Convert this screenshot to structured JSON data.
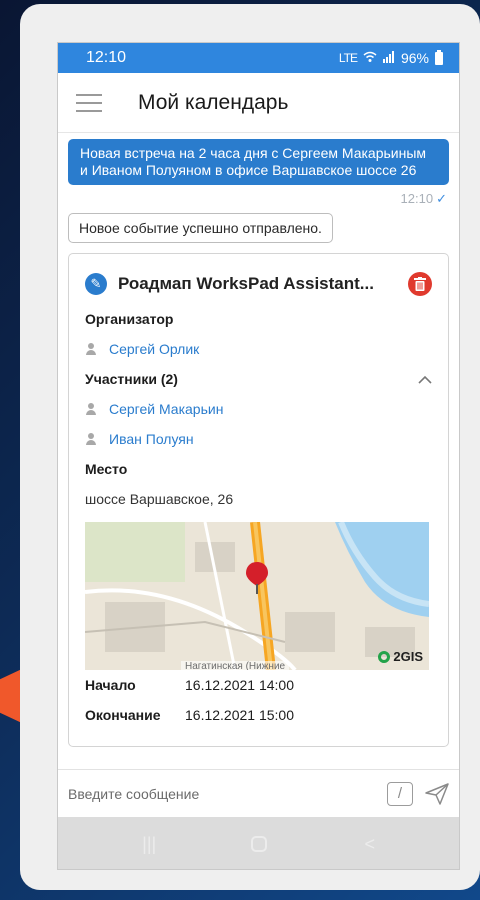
{
  "status_bar": {
    "time": "12:10",
    "network": "LTE",
    "battery": "96%"
  },
  "header": {
    "title": "Мой календарь",
    "menu_icon": "hamburger-icon"
  },
  "messages": {
    "outgoing_text": "Новая встреча на 2 часа дня с Сергеем Макарьиным и Иваном Полуяном в офисе Варшавское шоссе 26",
    "outgoing_time": "12:10",
    "toast_text": "Новое событие успешно отправлено."
  },
  "event": {
    "title": "Роадмап WorksPad Assistant...",
    "organizer_label": "Организатор",
    "organizer": "Сергей Орлик",
    "participants_label": "Участники (2)",
    "participants": [
      "Сергей Макарьин",
      "Иван Полуян"
    ],
    "place_label": "Место",
    "place": "шоссе Варшавское, 26",
    "map_caption": "Нагатинская (Нижние",
    "map_logo": "2GIS",
    "start_label": "Начало",
    "start": "16.12.2021 14:00",
    "end_label": "Окончание",
    "end": "16.12.2021 15:00"
  },
  "composer": {
    "placeholder": "Введите сообщение",
    "slash_symbol": "/"
  },
  "nav": {
    "recent_symbol": "|||",
    "back_symbol": "<"
  },
  "colors": {
    "accent": "#2f86de",
    "bubble": "#2a7ccd",
    "delete": "#e03a2e",
    "arrow": "#f0582b"
  }
}
